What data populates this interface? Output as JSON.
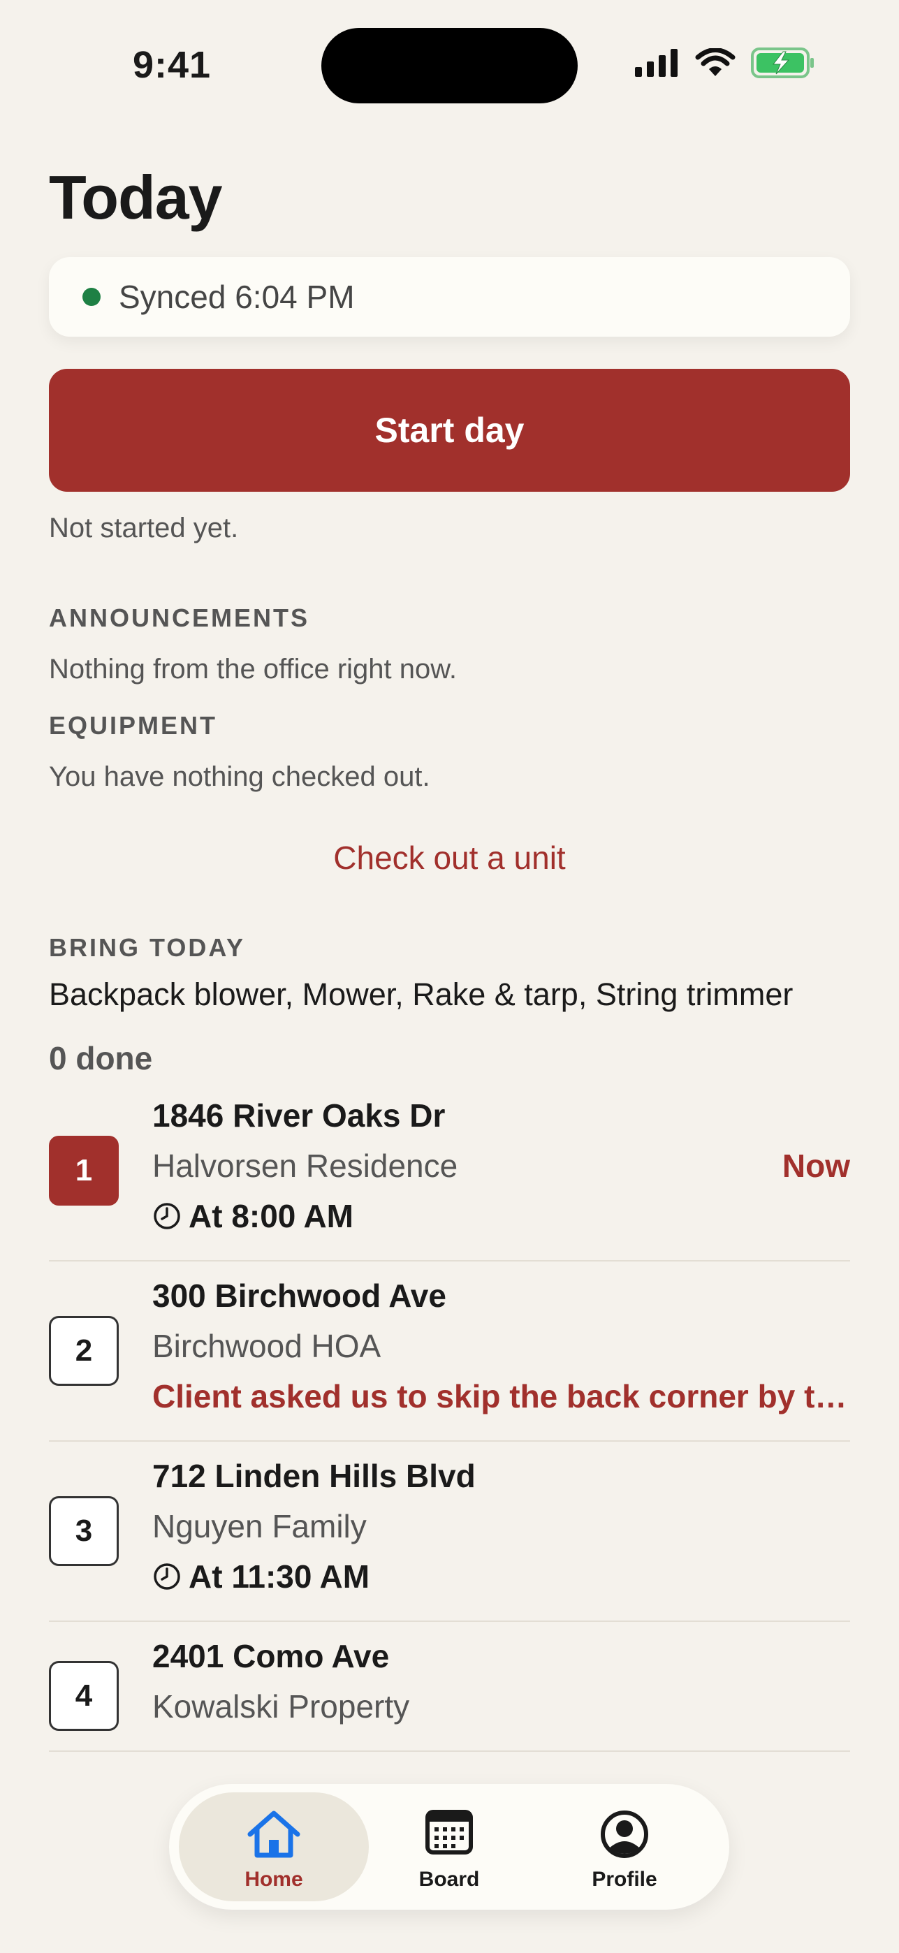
{
  "status_bar": {
    "time": "9:41",
    "icons": [
      "cellular-signal-icon",
      "wifi-icon",
      "battery-charging-icon"
    ]
  },
  "page": {
    "title": "Today"
  },
  "sync": {
    "text": "Synced 6:04 PM",
    "status_color": "#1e8044"
  },
  "start": {
    "button_label": "Start day",
    "status_text": "Not started yet."
  },
  "announcements": {
    "label": "ANNOUNCEMENTS",
    "text": "Nothing from the office right now."
  },
  "equipment": {
    "label": "EQUIPMENT",
    "text": "You have nothing checked out.",
    "link_label": "Check out a unit"
  },
  "bring_today": {
    "label": "BRING TODAY",
    "items": "Backpack blower, Mower, Rake & tarp, String trimmer"
  },
  "progress": {
    "done_text": "0 done"
  },
  "stops": [
    {
      "number": "1",
      "address": "1846 River Oaks Dr",
      "client": "Halvorsen Residence",
      "time": "At 8:00 AM",
      "badge": "Now"
    },
    {
      "number": "2",
      "address": "300 Birchwood Ave",
      "client": "Birchwood HOA",
      "note": "Client asked us to skip the back corner by the shed this week"
    },
    {
      "number": "3",
      "address": "712 Linden Hills Blvd",
      "client": "Nguyen Family",
      "time": "At 11:30 AM"
    },
    {
      "number": "4",
      "address": "2401 Como Ave",
      "client": "Kowalski Property"
    }
  ],
  "tabs": [
    {
      "label": "Home",
      "icon": "home-icon",
      "active": true
    },
    {
      "label": "Board",
      "icon": "calendar-icon",
      "active": false
    },
    {
      "label": "Profile",
      "icon": "profile-icon",
      "active": false
    }
  ],
  "colors": {
    "accent": "#a1302c",
    "background": "#f5f2ec",
    "card": "#fdfcf7",
    "home_icon": "#1a73e8"
  }
}
